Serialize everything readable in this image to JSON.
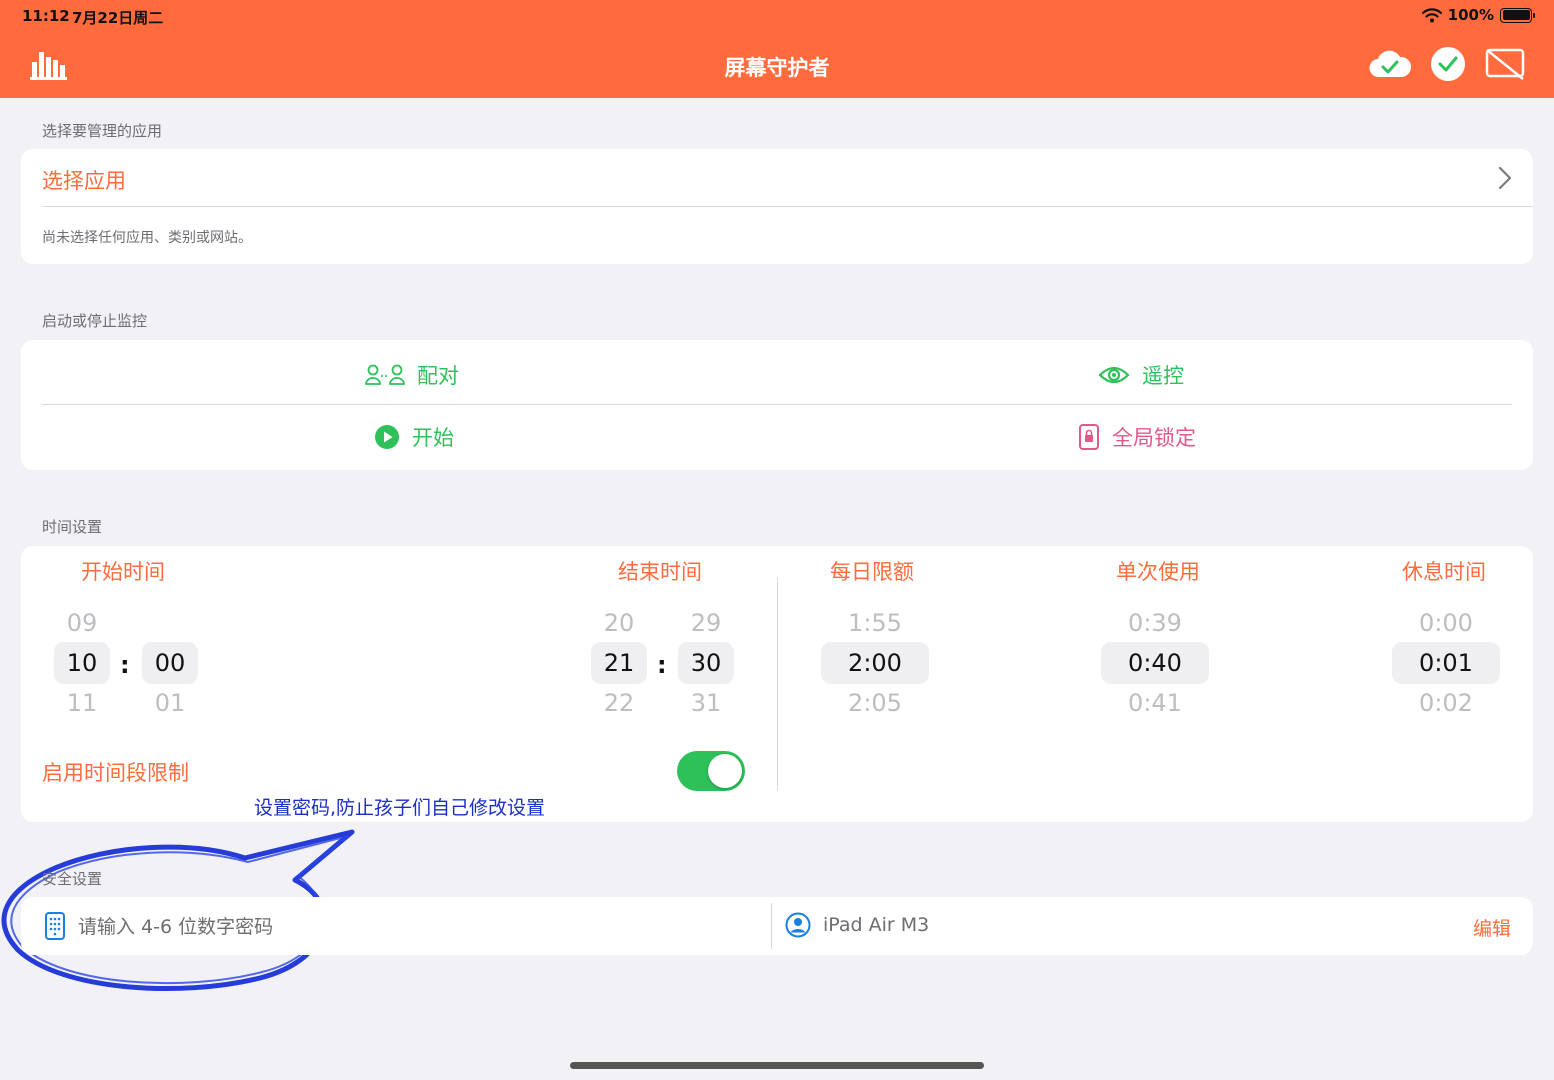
{
  "status": {
    "time": "11:12",
    "date": "7月22日周二",
    "battery": "100%"
  },
  "header": {
    "title": "屏幕守护者"
  },
  "apps": {
    "section_label": "选择要管理的应用",
    "select_label": "选择应用",
    "empty_text": "尚未选择任何应用、类别或网站。"
  },
  "monitor": {
    "section_label": "启动或停止监控",
    "pair": "配对",
    "remote": "遥控",
    "start": "开始",
    "global_lock": "全局锁定"
  },
  "time": {
    "section_label": "时间设置",
    "start_title": "开始时间",
    "end_title": "结束时间",
    "daily_title": "每日限额",
    "single_title": "单次使用",
    "rest_title": "休息时间",
    "start_hour": {
      "prev": "09",
      "value": "10",
      "next": "11"
    },
    "start_min": {
      "prev": "",
      "value": "00",
      "next": "01"
    },
    "end_hour": {
      "prev": "20",
      "value": "21",
      "next": "22"
    },
    "end_min": {
      "prev": "29",
      "value": "30",
      "next": "31"
    },
    "colon": ":",
    "daily": {
      "prev": "1:55",
      "value": "2:00",
      "next": "2:05"
    },
    "single": {
      "prev": "0:39",
      "value": "0:40",
      "next": "0:41"
    },
    "rest": {
      "prev": "0:00",
      "value": "0:01",
      "next": "0:02"
    },
    "enable_label": "启用时间段限制",
    "enable_on": true
  },
  "annotation": {
    "note": "设置密码,防止孩子们自己修改设置"
  },
  "security": {
    "section_label": "安全设置",
    "password_placeholder": "请输入 4-6 位数字密码",
    "device": "iPad Air M3",
    "edit": "编辑"
  },
  "colors": {
    "accent": "#ff6b3d",
    "green": "#2ec15a",
    "pink": "#e4578a",
    "annotation_blue": "#1a2fc8"
  }
}
